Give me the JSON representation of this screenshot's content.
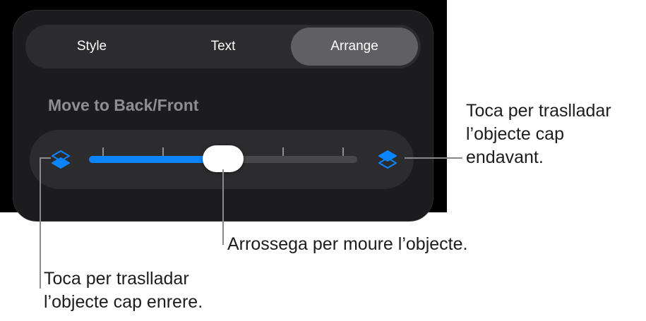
{
  "tabs": [
    {
      "label": "Style",
      "active": false
    },
    {
      "label": "Text",
      "active": false
    },
    {
      "label": "Arrange",
      "active": true
    }
  ],
  "section": {
    "title": "Move to Back/Front"
  },
  "slider": {
    "value": 0.5,
    "tick_count": 5,
    "back_icon": "layers-back-icon",
    "front_icon": "layers-front-icon",
    "accent_color": "#0a84ff"
  },
  "callouts": {
    "front": [
      "Toca per traslladar",
      "l’objecte cap",
      "endavant."
    ],
    "drag": [
      "Arrossega per moure l’objecte."
    ],
    "back": [
      "Toca per traslladar",
      "l’objecte cap enrere."
    ]
  }
}
